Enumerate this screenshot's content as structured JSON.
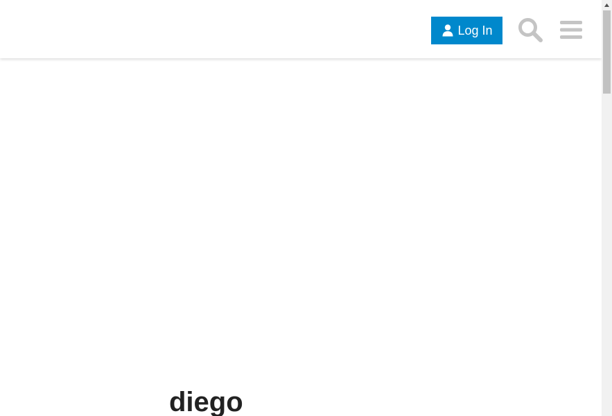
{
  "header": {
    "login_label": "Log In"
  },
  "icons": {
    "login": "user-icon",
    "search": "search-icon",
    "menu": "hamburger-menu-icon"
  },
  "profile": {
    "username": "diego"
  },
  "colors": {
    "primary": "#0088cc",
    "icon_gray": "#c4c4c4",
    "text": "#222222"
  }
}
